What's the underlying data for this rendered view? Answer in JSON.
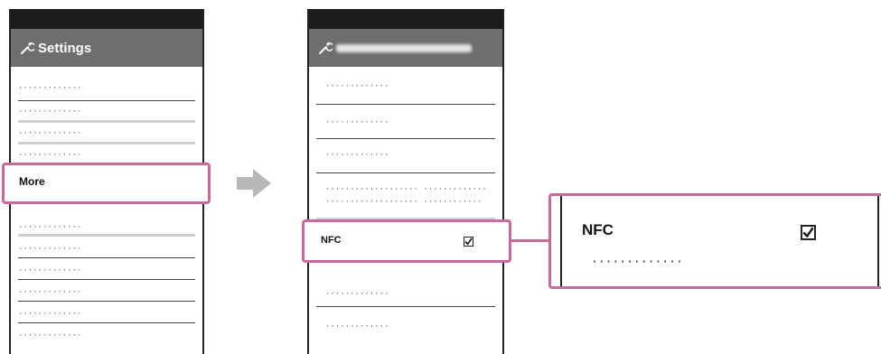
{
  "screen1": {
    "title": "Settings",
    "icon": "wrench-icon",
    "items": [
      {
        "text": "·············"
      },
      {
        "text": "·············"
      },
      {
        "text": "·············"
      },
      {
        "text": "·············"
      },
      {
        "text": "More"
      },
      {
        "text": "·············"
      },
      {
        "text": "·············"
      },
      {
        "text": "·············"
      },
      {
        "text": "·············"
      },
      {
        "text": "·············"
      },
      {
        "text": "·············"
      }
    ]
  },
  "screen2": {
    "icon": "wrench-icon",
    "items": [
      {
        "text": "·············"
      },
      {
        "text": "·············"
      },
      {
        "text": "·············"
      },
      {
        "text": "··················· ·············"
      },
      {
        "text": "··················· ············"
      },
      {
        "text": "NFC",
        "checked": true
      },
      {
        "text": "·············"
      },
      {
        "text": "·············"
      }
    ]
  },
  "zoom": {
    "label": "NFC",
    "summary": "·············",
    "checked": true
  },
  "colors": {
    "highlight": "#c9699c",
    "titlebar": "#6e6e6e",
    "statusbar": "#1c1c1c",
    "arrow": "#b8b8b8"
  }
}
